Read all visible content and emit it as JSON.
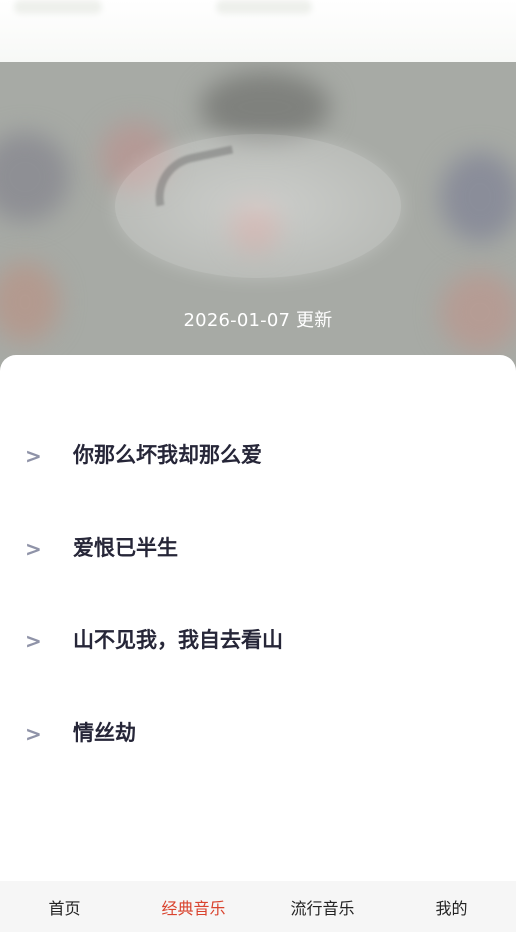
{
  "banner": {
    "update_text": "2026-01-07 更新"
  },
  "songs": [
    {
      "arrow": ">",
      "title": "你那么坏我却那么爱"
    },
    {
      "arrow": ">",
      "title": "爱恨已半生"
    },
    {
      "arrow": ">",
      "title": "山不见我，我自去看山"
    },
    {
      "arrow": ">",
      "title": "情丝劫"
    }
  ],
  "tabbar": {
    "tabs": [
      {
        "label": "首页"
      },
      {
        "label": "经典音乐"
      },
      {
        "label": "流行音乐"
      },
      {
        "label": "我的"
      }
    ],
    "active_color": "#d9432e"
  }
}
